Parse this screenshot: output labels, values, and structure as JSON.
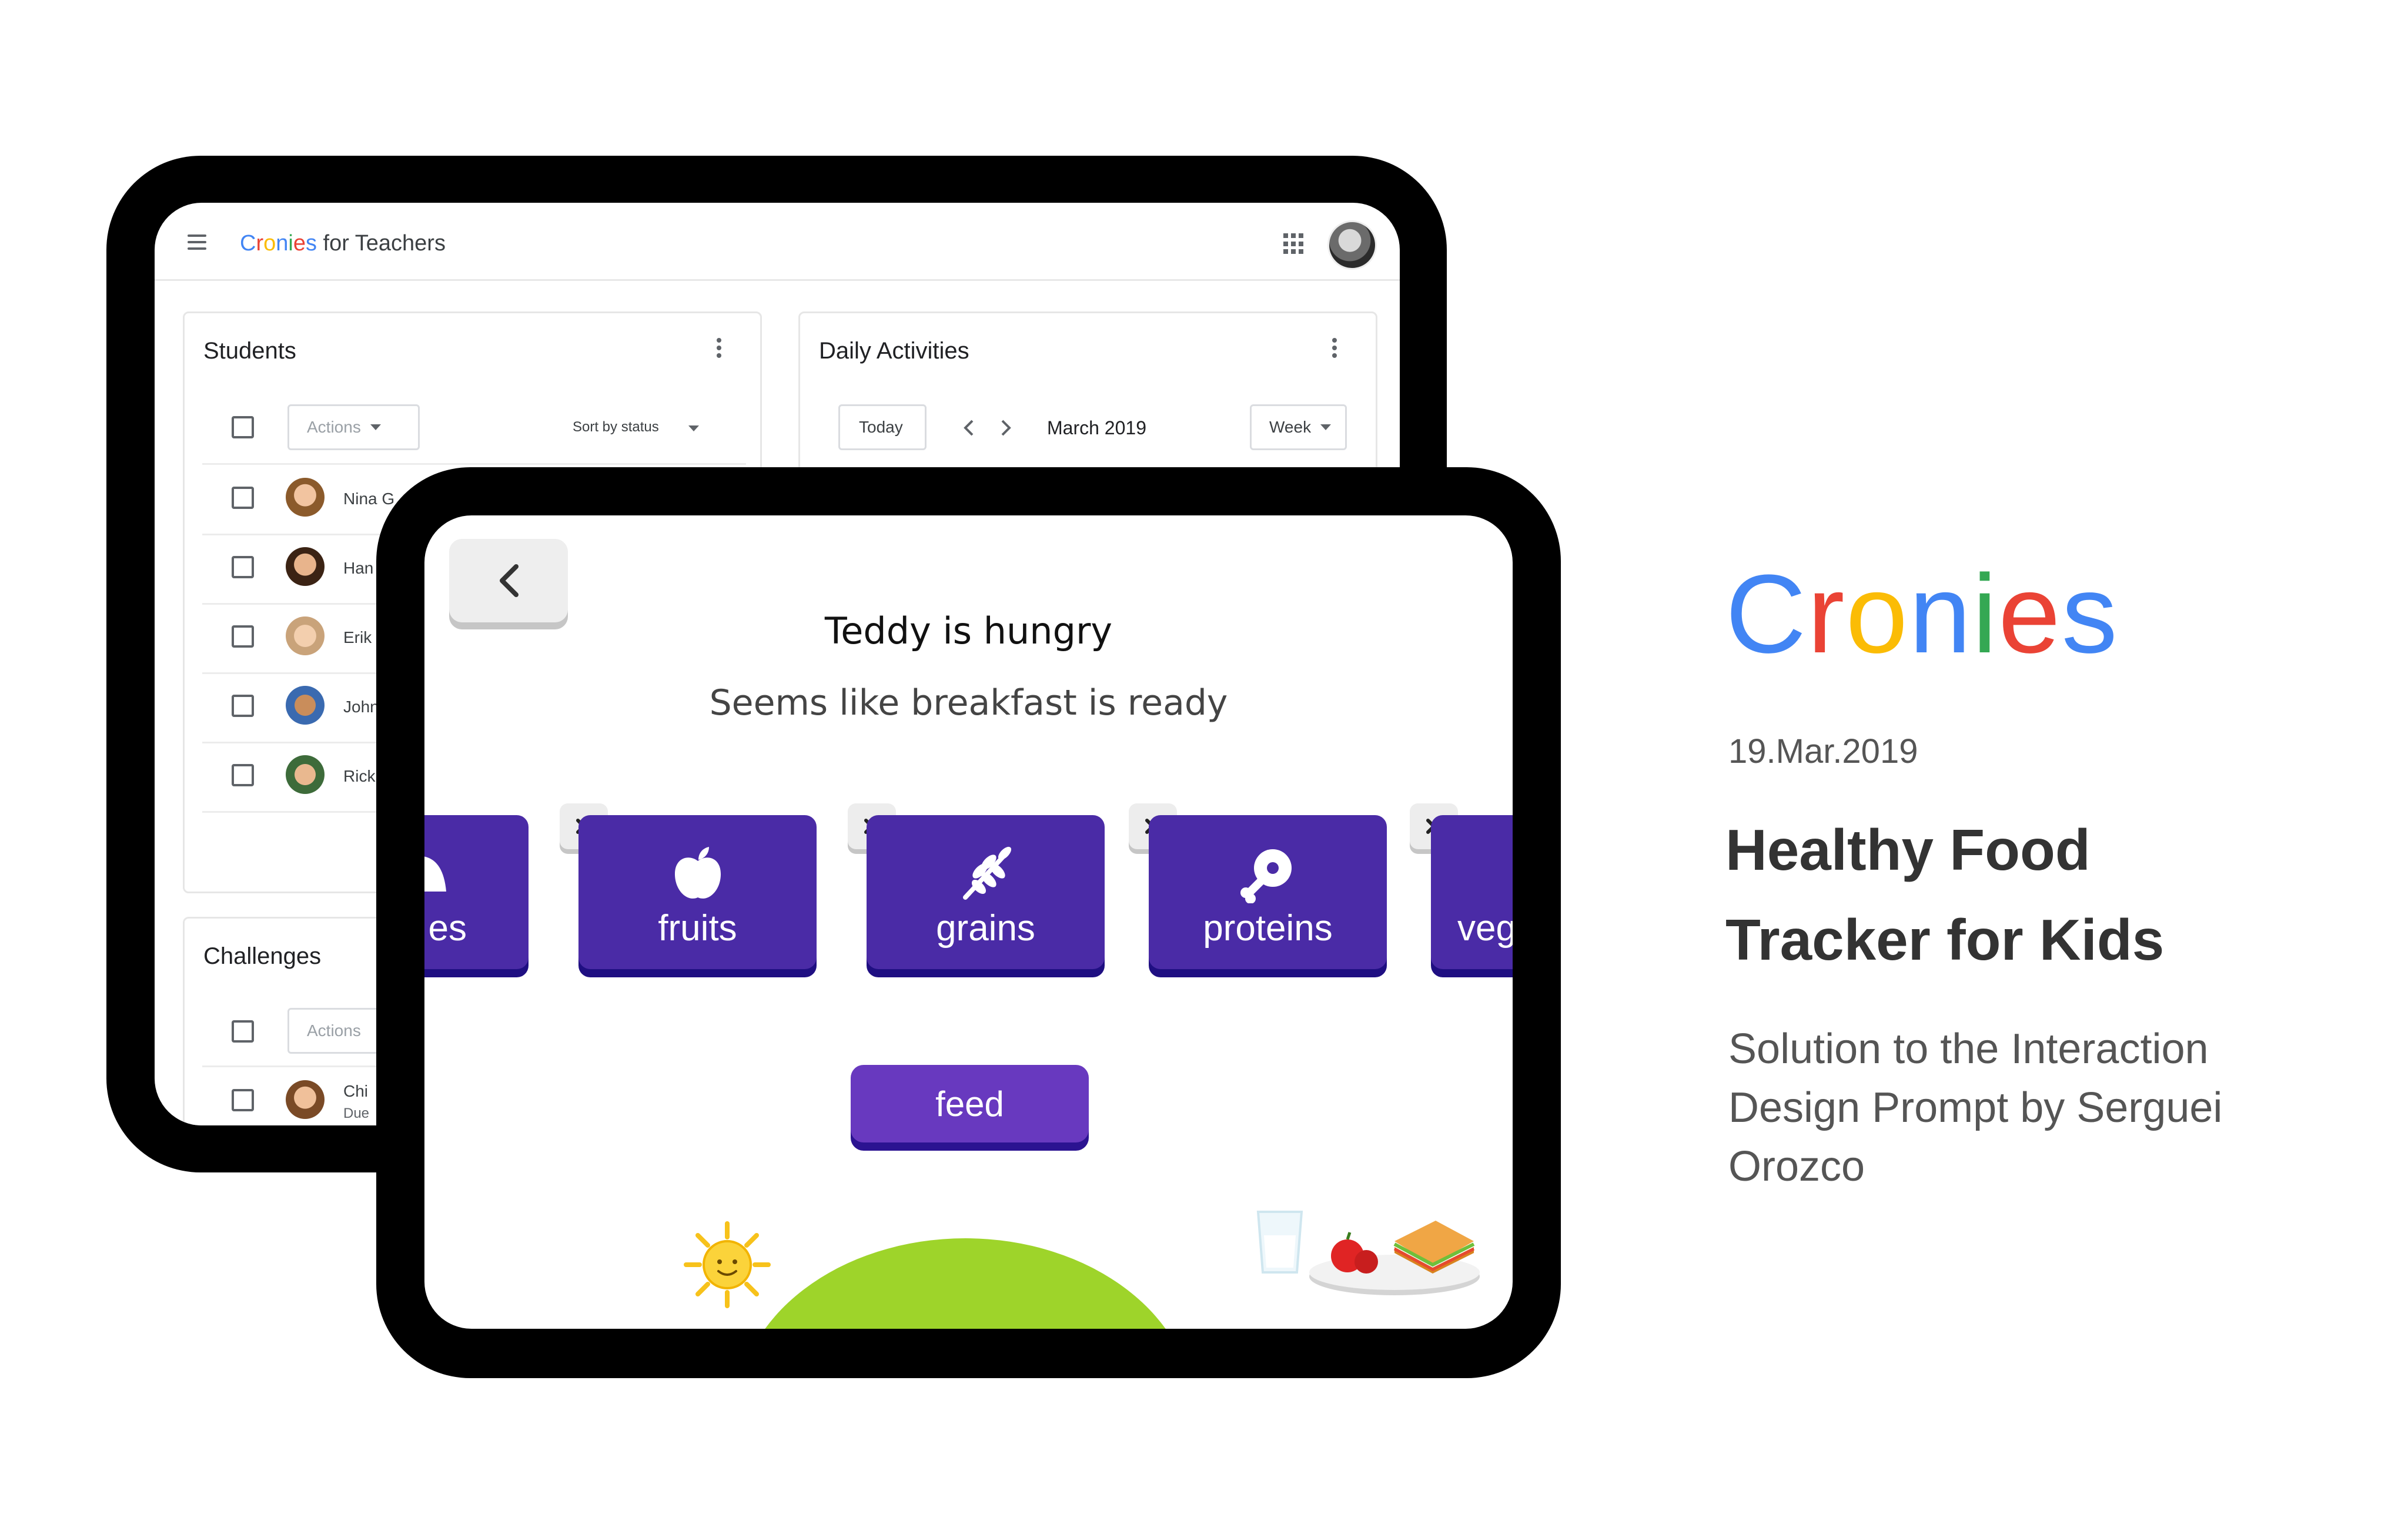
{
  "teacher_app": {
    "brand": [
      "C",
      "r",
      "o",
      "n",
      "i",
      "e",
      "s"
    ],
    "brand_colors": [
      "#4285F4",
      "#EA4335",
      "#FBBC05",
      "#4285F4",
      "#34A853",
      "#EA4335",
      "#4285F4"
    ],
    "title_suffix": " for Teachers",
    "students": {
      "title": "Students",
      "actions_label": "Actions",
      "sort_label": "Sort by status",
      "rows": [
        {
          "name": "Nina G"
        },
        {
          "name": "Han"
        },
        {
          "name": "Erik"
        },
        {
          "name": "John"
        },
        {
          "name": "Rick"
        }
      ]
    },
    "daily_activities": {
      "title": "Daily Activities",
      "today_label": "Today",
      "month_label": "March 2019",
      "view_label": "Week"
    },
    "challenges": {
      "title": "Challenges",
      "actions_label": "Actions",
      "rows": [
        {
          "name": "Chi",
          "sub": "Due"
        }
      ]
    }
  },
  "kids_app": {
    "title": "Teddy is hungry",
    "subtitle": "Seems like breakfast is ready",
    "foods": [
      {
        "label": "es",
        "icon": "dairy-icon"
      },
      {
        "label": "fruits",
        "icon": "apple-icon"
      },
      {
        "label": "grains",
        "icon": "wheat-icon"
      },
      {
        "label": "proteins",
        "icon": "drumstick-icon"
      },
      {
        "label": "vege",
        "icon": "vegetable-icon"
      }
    ],
    "feed_label": "feed",
    "colors": {
      "tile": "#4a2ba6",
      "feed": "#6839bf",
      "hill": "#9ed42a"
    }
  },
  "panel": {
    "brand": [
      "C",
      "r",
      "o",
      "n",
      "i",
      "e",
      "s"
    ],
    "date": "19.Mar.2019",
    "headline_line1": "Healthy Food",
    "headline_line2": "Tracker for Kids",
    "description": "Solution to the Interaction Design Prompt by Serguei Orozco"
  }
}
